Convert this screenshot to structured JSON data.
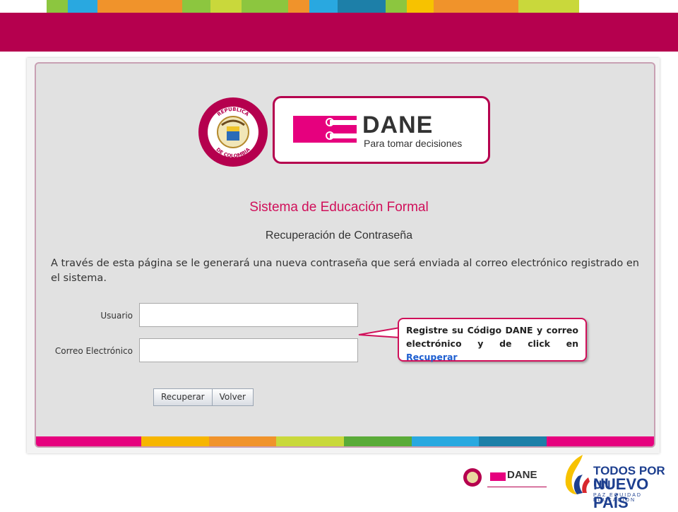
{
  "header": {
    "brand_color": "#b5004e",
    "stripe_colors": [
      "#8cc63f",
      "#29a8e0",
      "#f0932b",
      "#f0932b",
      "#8cc63f",
      "#c9d83b",
      "#ffffff",
      "#8cc63f",
      "#f0932b",
      "#29a8e0",
      "#1d7fa8",
      "#8cc63f",
      "#f7c200",
      "#f0932b",
      "#c9d83b"
    ]
  },
  "logos": {
    "seal_icon": "republica-de-colombia-seal-icon",
    "dane_word": "DANE",
    "dane_tagline": "Para tomar decisiones"
  },
  "page": {
    "title": "Sistema de Educación Formal",
    "subtitle": "Recuperación de Contraseña",
    "intro": "A través de esta página se le generará una nueva contraseña que será enviada al correo electrónico registrado en el sistema."
  },
  "form": {
    "user_label": "Usuario",
    "user_value": "",
    "email_label": "Correo Electrónico",
    "email_value": "",
    "recover_label": "Recuperar",
    "back_label": "Volver"
  },
  "callout": {
    "text_before": "Registre su Código DANE y correo electrónico y de click en ",
    "highlight": "Recuperar"
  },
  "bottom_stripe_colors": [
    "#e6007e",
    "#e6007e",
    "#f7b500",
    "#f0932b",
    "#c9d83b",
    "#5aab38",
    "#29a8e0",
    "#1d7fa8",
    "#e6007e"
  ],
  "footer": {
    "dane_word": "DANE",
    "slogan_line1": "TODOS POR UN",
    "slogan_line2": "NUEVO PAÍS",
    "slogan_line3": "PAZ  EQUIDAD  EDUCACIÓN"
  }
}
